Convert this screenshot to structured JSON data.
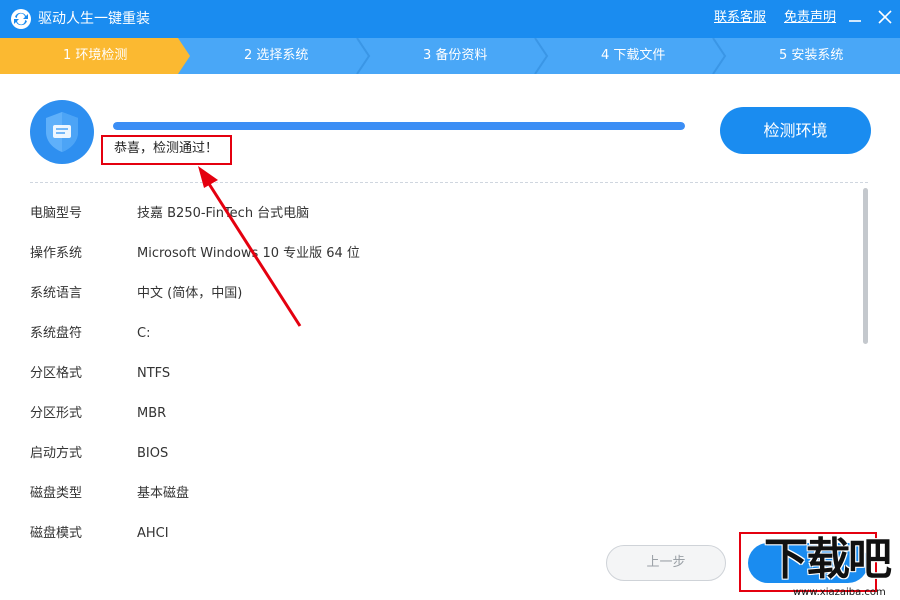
{
  "window": {
    "title": "驱动人生一键重装",
    "links": {
      "contact": "联系客服",
      "disclaimer": "免责声明"
    }
  },
  "steps": [
    {
      "label": "1 环境检测",
      "active": true
    },
    {
      "label": "2 选择系统",
      "active": false
    },
    {
      "label": "3 备份资料",
      "active": false
    },
    {
      "label": "4 下载文件",
      "active": false
    },
    {
      "label": "5 安装系统",
      "active": false
    }
  ],
  "detection": {
    "progress_percent": 100,
    "status": "恭喜，检测通过！",
    "button": "检测环境"
  },
  "info": [
    {
      "label": "电脑型号",
      "value": "技嘉 B250-FinTech 台式电脑"
    },
    {
      "label": "操作系统",
      "value": "Microsoft Windows 10 专业版 64 位"
    },
    {
      "label": "系统语言",
      "value": "中文 (简体，中国)"
    },
    {
      "label": "系统盘符",
      "value": "C:"
    },
    {
      "label": "分区格式",
      "value": "NTFS"
    },
    {
      "label": "分区形式",
      "value": "MBR"
    },
    {
      "label": "启动方式",
      "value": "BIOS"
    },
    {
      "label": "磁盘类型",
      "value": "基本磁盘"
    },
    {
      "label": "磁盘模式",
      "value": "AHCI"
    }
  ],
  "footer": {
    "prev": "上一步"
  },
  "watermark": {
    "text": "下载吧",
    "domain": "www.xiazaiba.com"
  },
  "colors": {
    "titlebar": "#1a8cf0",
    "active_step": "#fbb931",
    "inactive_step": "#49a7f7",
    "highlight": "#e4000f"
  },
  "icons": [
    "app-logo-icon",
    "minimize-icon",
    "close-icon",
    "shield-icon",
    "arrow-annotation"
  ]
}
